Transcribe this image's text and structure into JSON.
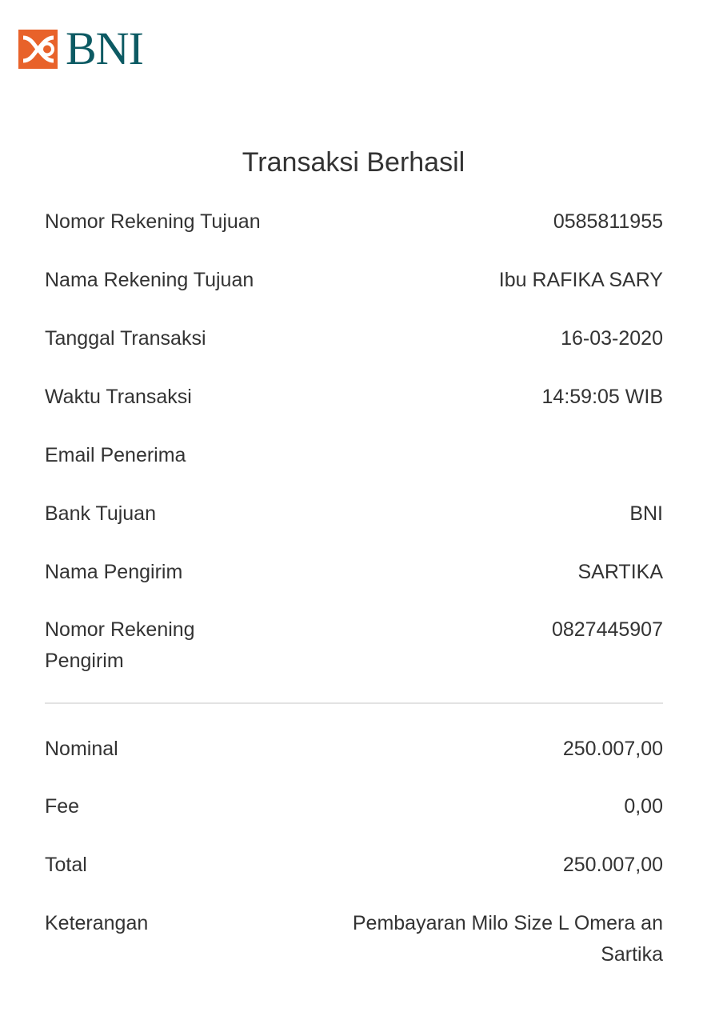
{
  "brand": {
    "logo_text": "BNI",
    "primary_color": "#0c5a63",
    "accent_color": "#e8622a"
  },
  "title": "Transaksi Berhasil",
  "details": [
    {
      "label": "Nomor Rekening Tujuan",
      "value": "0585811955"
    },
    {
      "label": "Nama Rekening Tujuan",
      "value": "Ibu RAFIKA SARY"
    },
    {
      "label": "Tanggal Transaksi",
      "value": "16-03-2020"
    },
    {
      "label": "Waktu Transaksi",
      "value": "14:59:05 WIB"
    },
    {
      "label": "Email Penerima",
      "value": ""
    },
    {
      "label": "Bank Tujuan",
      "value": "BNI"
    },
    {
      "label": "Nama Pengirim",
      "value": "SARTIKA"
    },
    {
      "label": "Nomor Rekening Pengirim",
      "value": "0827445907"
    }
  ],
  "summary": [
    {
      "label": "Nominal",
      "value": "250.007,00"
    },
    {
      "label": "Fee",
      "value": "0,00"
    },
    {
      "label": "Total",
      "value": "250.007,00"
    },
    {
      "label": "Keterangan",
      "value": "Pembayaran Milo Size L Omera an Sartika"
    }
  ]
}
